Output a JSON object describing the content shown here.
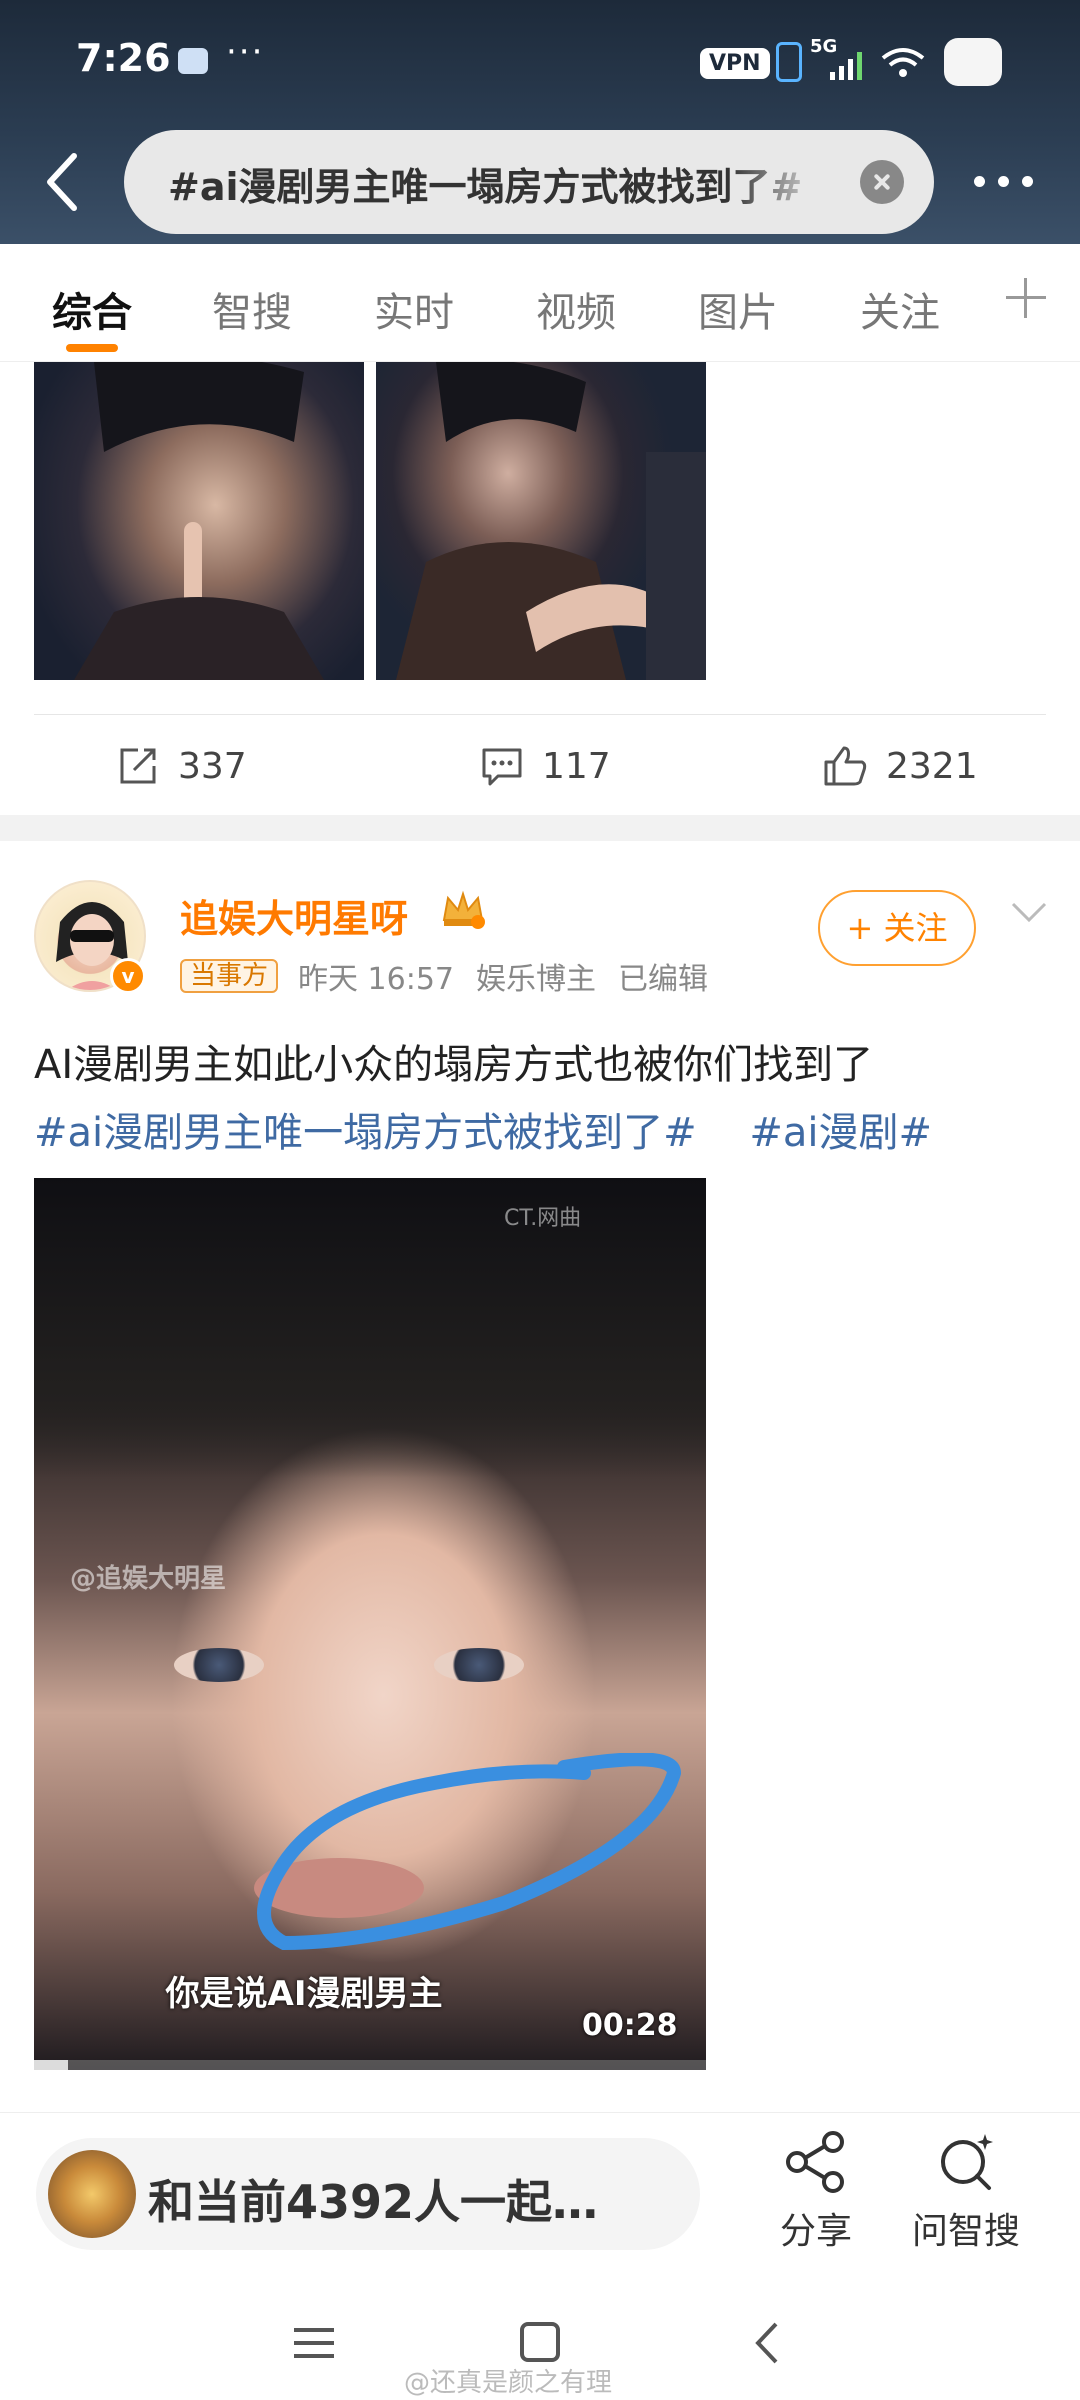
{
  "status_bar": {
    "time": "7:26",
    "dots": "···",
    "vpn": "VPN",
    "network": "5G",
    "wifi_sub": "6"
  },
  "header": {
    "search_text": "#ai漫剧男主唯一塌房方式被找到了#",
    "back_icon": "chevron-left-icon",
    "more_icon": "more-horizontal-icon"
  },
  "tabs": [
    {
      "label": "综合",
      "active": true
    },
    {
      "label": "智搜",
      "active": false
    },
    {
      "label": "实时",
      "active": false
    },
    {
      "label": "视频",
      "active": false
    },
    {
      "label": "图片",
      "active": false
    },
    {
      "label": "关注",
      "active": false
    }
  ],
  "post1": {
    "repost_count": "337",
    "comment_count": "117",
    "like_count": "2321"
  },
  "post2": {
    "username": "追娱大明星呀",
    "badge": "当事方",
    "time": "昨天 16:57",
    "role": "娱乐博主",
    "edited": "已编辑",
    "follow_label": "+ 关注",
    "text": "AI漫剧男主如此小众的塌房方式也被你们找到了",
    "hashtags": [
      "#ai漫剧男主唯一塌房方式被找到了#",
      "#ai漫剧#"
    ],
    "video": {
      "watermark_top": "CT.网曲",
      "watermark_mid": "@追娱大明星",
      "subtitle": "你是说AI漫剧男主",
      "duration": "00:28",
      "progress": 0.05,
      "annotation_color": "#3a8fe0"
    }
  },
  "bottom_bar": {
    "live_text": "和当前4392人一起…",
    "share_label": "分享",
    "ask_label": "问智搜"
  },
  "page_watermark": "@还真是颜之有理",
  "colors": {
    "accent": "#ff8200",
    "link": "#3f6aa3",
    "header_bg": "#1d2a3a"
  }
}
